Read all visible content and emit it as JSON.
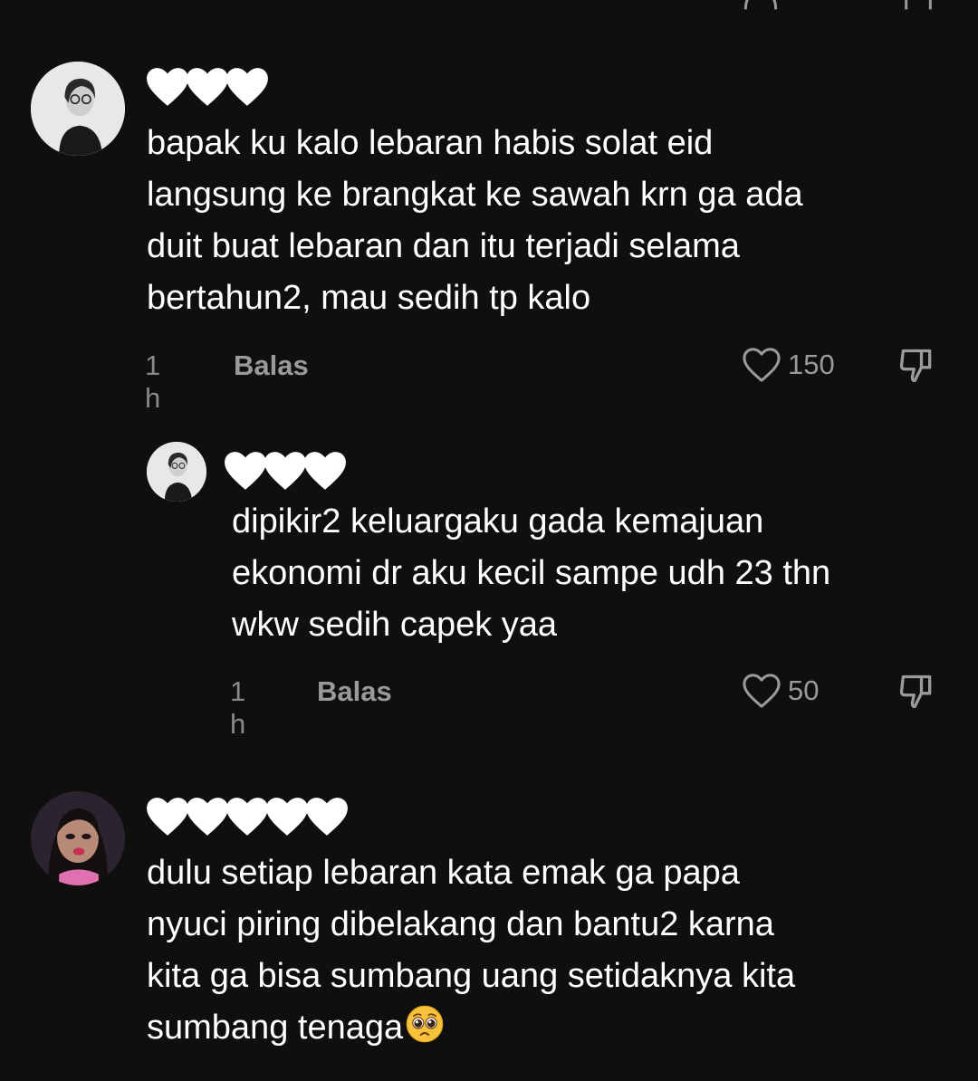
{
  "comments": [
    {
      "username_icons": [
        "heart-icon",
        "heart-icon",
        "heart-icon"
      ],
      "text": "bapak ku kalo lebaran habis solat eid\nlangsung ke brangkat ke sawah krn ga ada\nduit buat lebaran dan itu terjadi selama\nbertahun2, mau sedih tp kalo",
      "time": "1 h",
      "reply_label": "Balas",
      "likes": "150"
    },
    {
      "is_reply": true,
      "username_icons": [
        "heart-icon",
        "heart-icon",
        "heart-icon"
      ],
      "text": "dipikir2 keluargaku gada kemajuan\nekonomi dr aku kecil sampe udh 23 thn\nwkw sedih capek yaa",
      "time": "1 h",
      "reply_label": "Balas",
      "likes": "50"
    },
    {
      "username_icons": [
        "heart-icon",
        "heart-icon",
        "heart-icon",
        "heart-icon",
        "heart-icon"
      ],
      "text": "dulu setiap lebaran kata emak ga papa\nnyuci piring dibelakang dan bantu2 karna\nkita ga bisa sumbang uang setidaknya kita\nsumbang tenaga",
      "trailing_emoji": "pleading-face-icon"
    }
  ],
  "colors": {
    "background": "#0f0f0f",
    "text": "#ffffff",
    "muted": "#8a8a8a"
  }
}
